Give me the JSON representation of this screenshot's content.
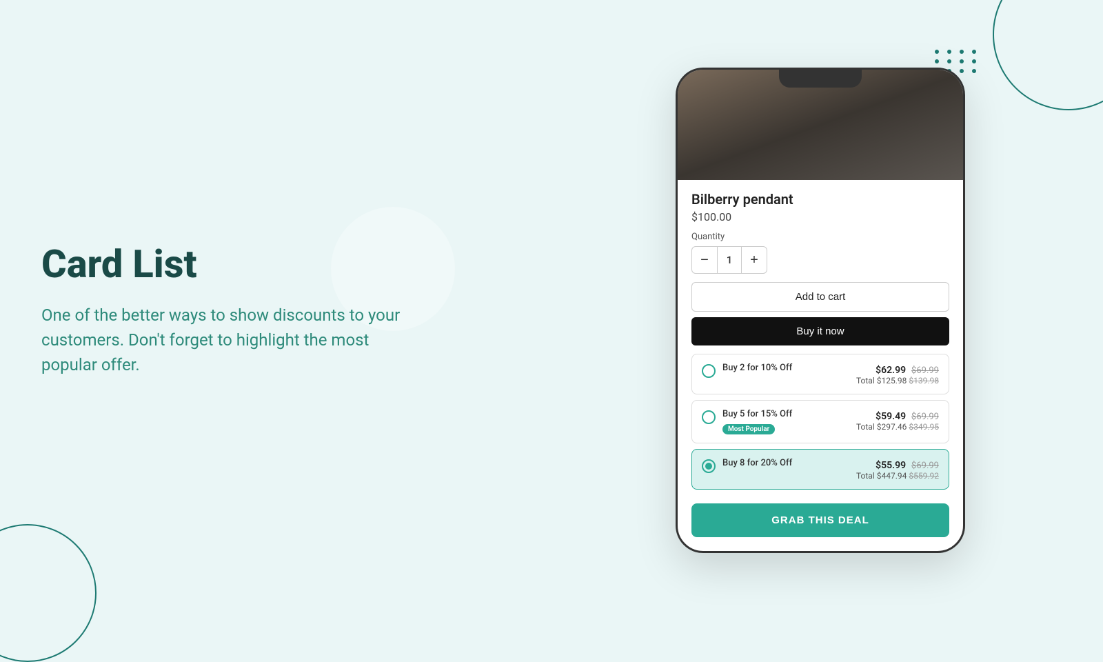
{
  "page": {
    "background_color": "#eaf6f6"
  },
  "left": {
    "title": "Card List",
    "description": "One of the better ways to show discounts to your customers. Don't forget to highlight the most popular offer."
  },
  "phone": {
    "product": {
      "name": "Bilberry pendant",
      "price": "$100.00",
      "quantity_label": "Quantity",
      "quantity_value": "1",
      "qty_minus": "−",
      "qty_plus": "+"
    },
    "buttons": {
      "add_to_cart": "Add to cart",
      "buy_it_now": "Buy it now"
    },
    "deals": [
      {
        "id": "deal-1",
        "label": "Buy 2 for 10% Off",
        "new_price": "$62.99",
        "old_price": "$69.99",
        "total_new": "$125.98",
        "total_old": "$139.98",
        "selected": false,
        "most_popular": false
      },
      {
        "id": "deal-2",
        "label": "Buy 5 for 15% Off",
        "new_price": "$59.49",
        "old_price": "$69.99",
        "total_new": "$297.46",
        "total_old": "$349.95",
        "selected": false,
        "most_popular": true,
        "badge": "Most Popular"
      },
      {
        "id": "deal-3",
        "label": "Buy 8 for 20% Off",
        "new_price": "$55.99",
        "old_price": "$69.99",
        "total_new": "$447.94",
        "total_old": "$559.92",
        "selected": true,
        "most_popular": false
      }
    ],
    "grab_deal_btn": "GRAB THIS DEAL"
  }
}
